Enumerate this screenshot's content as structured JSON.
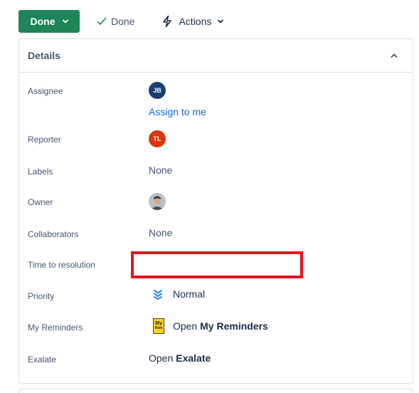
{
  "toolbar": {
    "status_label": "Done",
    "done_label": "Done",
    "actions_label": "Actions"
  },
  "details": {
    "title": "Details",
    "fields": {
      "assignee": {
        "label": "Assignee",
        "initials": "JB",
        "assign_link": "Assign to me"
      },
      "reporter": {
        "label": "Reporter",
        "initials": "TL"
      },
      "labels": {
        "label": "Labels",
        "value": "None"
      },
      "owner": {
        "label": "Owner"
      },
      "collaborators": {
        "label": "Collaborators",
        "value": "None"
      },
      "time_to_resolution": {
        "label": "Time to resolution"
      },
      "priority": {
        "label": "Priority",
        "value": "Normal"
      },
      "my_reminders": {
        "label": "My Reminders",
        "icon_text_1": "My",
        "icon_text_2": "Rem",
        "prefix": "Open",
        "name": "My Reminders"
      },
      "exalate": {
        "label": "Exalate",
        "prefix": "Open",
        "name": "Exalate"
      }
    }
  },
  "colors": {
    "status_green": "#1f845a",
    "link_blue": "#0c66e4",
    "highlight_red": "#e3141e",
    "reporter_avatar": "#de350b",
    "assignee_avatar": "#1d3f6e"
  }
}
